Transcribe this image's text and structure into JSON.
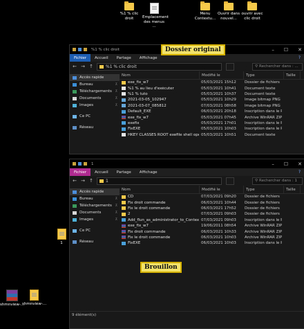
{
  "desktop_icons": [
    {
      "label": "%1 % clic droit",
      "type": "folder"
    },
    {
      "label": "Emplacement des menus ...",
      "type": "doc"
    },
    {
      "label": "Menu Contextu...",
      "type": "folder"
    },
    {
      "label": "Ouvrir dans nouvel...",
      "type": "folder"
    },
    {
      "label": "ouvrir avec clic droit",
      "type": "folder"
    }
  ],
  "desktop_icons_bottom": [
    {
      "label": "shmnview-...",
      "type": "rar"
    },
    {
      "label": "shmnview-...",
      "type": "folder"
    }
  ],
  "desktop_icon_left": {
    "label": "1",
    "type": "folder"
  },
  "window1": {
    "title": "%1 % clic droit",
    "annotation": "Dossier original",
    "ribbon": [
      "Fichier",
      "Accueil",
      "Partage",
      "Affichage"
    ],
    "path": "%1 % clic droit",
    "search_placeholder": "Rechercher dans : ...",
    "nav": [
      "Accès rapide",
      "Bureau",
      "Téléchargements",
      "Documents",
      "Images",
      "Ce PC",
      "Réseau"
    ],
    "columns": [
      "Nom",
      "Modifié le",
      "Type",
      "Taille"
    ],
    "files": [
      {
        "name": "exe_fix_w7",
        "date": "05/03/2021 15h12",
        "type": "Dossier de fichiers",
        "icon": "folder"
      },
      {
        "name": "%1 % au lieu d'exécuter",
        "date": "05/03/2021 10h41",
        "type": "Document texte",
        "icon": "txt"
      },
      {
        "name": "%1 % tuto",
        "date": "05/03/2021 10h37",
        "type": "Document texte",
        "icon": "txt"
      },
      {
        "name": "2021-03-05_102947",
        "date": "05/03/2021 10h29",
        "type": "Image bitmap PNG",
        "icon": "png"
      },
      {
        "name": "2021-03-07_085812",
        "date": "07/03/2021 08h58",
        "type": "Image bitmap PNG",
        "icon": "png"
      },
      {
        "name": "Default_EXE",
        "date": "06/03/2021 20h18",
        "type": "Inscription dans le Re",
        "icon": "reg"
      },
      {
        "name": "exe_fix_w7",
        "date": "05/03/2021 07h45",
        "type": "Archive WinRAR ZIP",
        "icon": "rar"
      },
      {
        "name": "exefix",
        "date": "05/03/2021 17h01",
        "type": "Inscription dans le Re",
        "icon": "reg"
      },
      {
        "name": "FixEXE",
        "date": "05/03/2021 10h03",
        "type": "Inscription dans le Re",
        "icon": "reg"
      },
      {
        "name": "HKEY CLASSES ROOT exefile shell open",
        "date": "05/03/2021 10h51",
        "type": "Document texte",
        "icon": "txt"
      }
    ]
  },
  "window2": {
    "title": "1",
    "annotation": "Brouillon",
    "ribbon": [
      "Fichier",
      "Accueil",
      "Partage",
      "Affichage"
    ],
    "path": "1",
    "search_placeholder": "Rechercher dans : 1",
    "nav": [
      "Accès rapide",
      "Bureau",
      "Téléchargements",
      "Documents",
      "Images",
      "Ce PC",
      "Réseau"
    ],
    "columns": [
      "Nom",
      "Modifié le",
      "Type",
      "Taille"
    ],
    "files": [
      {
        "name": "CD",
        "date": "07/03/2021 09h20",
        "type": "Dossier de fichiers",
        "icon": "folder"
      },
      {
        "name": "Fix droit commande",
        "date": "06/03/2021 10h44",
        "type": "Dossier de fichiers",
        "icon": "folder"
      },
      {
        "name": "Fix le droit commande",
        "date": "06/03/2021 17h52",
        "type": "Dossier de fichiers",
        "icon": "folder"
      },
      {
        "name": "2",
        "date": "07/03/2021 09h03",
        "type": "Dossier de fichiers",
        "icon": "folder"
      },
      {
        "name": "Add_flun_as_administrator_to_Context_...",
        "date": "07/03/2021 09h03",
        "type": "Inscription dans le Re",
        "icon": "reg"
      },
      {
        "name": "exe_fix_w7",
        "date": "19/06/2011 08h54",
        "type": "Archive WinRAR ZIP",
        "icon": "rar"
      },
      {
        "name": "Fix droit commande",
        "date": "06/03/2021 10h33",
        "type": "Archive WinRAR ZIP",
        "icon": "rar"
      },
      {
        "name": "Fix le droit commande",
        "date": "06/03/2021 10h03",
        "type": "Archive WinRAR ZIP",
        "icon": "rar"
      },
      {
        "name": "FixEXE",
        "date": "06/03/2021 10h03",
        "type": "Inscription dans le Re",
        "icon": "reg"
      }
    ],
    "status": "9 élément(s)"
  },
  "colors": {
    "accent_blue": "#1f5fb3",
    "accent_pink": "#b02b8f",
    "badge_yellow": "#f3e36a"
  }
}
